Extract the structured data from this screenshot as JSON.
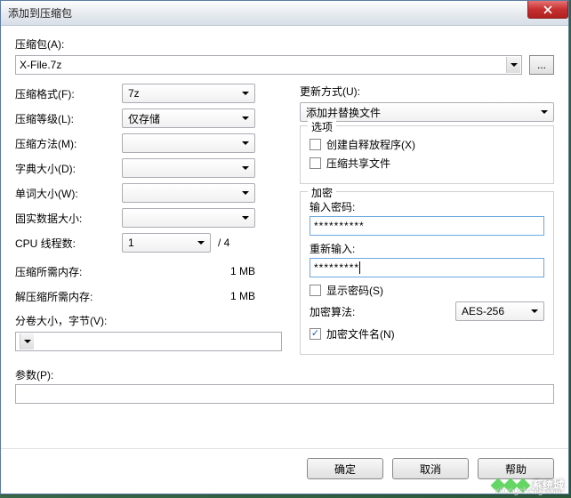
{
  "window": {
    "title": "添加到压缩包"
  },
  "archive": {
    "label": "压缩包(A):",
    "value": "X-File.7z",
    "browse": "..."
  },
  "left": {
    "format_label": "压缩格式(F):",
    "format_value": "7z",
    "level_label": "压缩等级(L):",
    "level_value": "仅存储",
    "method_label": "压缩方法(M):",
    "method_value": "",
    "dict_label": "字典大小(D):",
    "dict_value": "",
    "word_label": "单词大小(W):",
    "word_value": "",
    "solid_label": "固实数据大小:",
    "solid_value": "",
    "threads_label": "CPU 线程数:",
    "threads_value": "1",
    "threads_suffix": "/ 4",
    "mem_comp_label": "压缩所需内存:",
    "mem_comp_value": "1 MB",
    "mem_decomp_label": "解压缩所需内存:",
    "mem_decomp_value": "1 MB",
    "split_label": "分卷大小，字节(V):",
    "split_value": ""
  },
  "right": {
    "update_label": "更新方式(U):",
    "update_value": "添加并替换文件",
    "options_legend": "选项",
    "opt_sfx": "创建自释放程序(X)",
    "opt_shared": "压缩共享文件",
    "enc_legend": "加密",
    "pwd_label": "输入密码:",
    "pwd_value": "**********",
    "pwd2_label": "重新输入:",
    "pwd2_value": "*********",
    "show_pwd": "显示密码(S)",
    "enc_method_label": "加密算法:",
    "enc_method_value": "AES-256",
    "enc_names": "加密文件名(N)"
  },
  "params": {
    "label": "参数(P):"
  },
  "buttons": {
    "ok": "确定",
    "cancel": "取消",
    "help": "帮助"
  },
  "watermark": {
    "text": "系统城",
    "sub": "xitongcheng.com"
  }
}
